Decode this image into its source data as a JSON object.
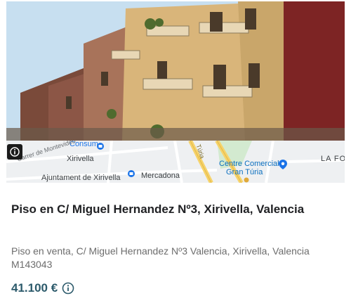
{
  "listing": {
    "title": "Piso en C/ Miguel Hernandez Nº3, Xirivella, Valencia",
    "description": "Piso en venta, C/ Miguel Hernandez Nº3 Valencia, Xirivella, Valencia M143043",
    "price": "41.100 €"
  },
  "map": {
    "label_consum": "Consum",
    "label_street": "Carrer de Montevideo",
    "label_xirivella": "Xirivella",
    "label_turia": "Túria",
    "label_centre_line1": "Centre Comercial",
    "label_centre_line2": "Gran Túria",
    "label_ajuntament": "Ajuntament de Xirivella",
    "label_mercadona": "Mercadona",
    "label_lafo": "LA FO"
  },
  "icons": {
    "photo_info": "info-icon",
    "price_info": "info-circle-icon"
  },
  "colors": {
    "price": "#2c5a6b",
    "title": "#202124",
    "description": "#6d6d6d",
    "map_poi": "#1a73e8"
  }
}
